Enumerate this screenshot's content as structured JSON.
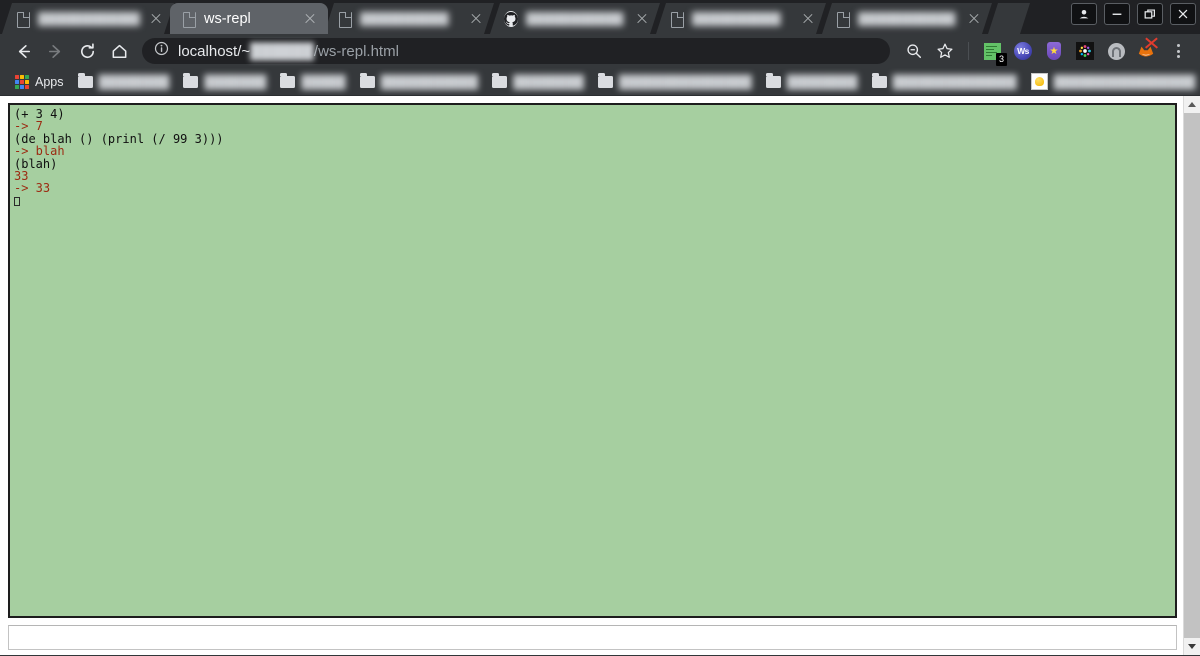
{
  "window": {
    "controls": [
      {
        "name": "profile-button",
        "icon": "person-icon"
      },
      {
        "name": "minimize-button",
        "icon": "minimize-icon"
      },
      {
        "name": "restore-button",
        "icon": "restore-icon"
      },
      {
        "name": "close-button",
        "icon": "close-icon"
      }
    ]
  },
  "tabs": [
    {
      "title": "████████████",
      "active": false,
      "favicon": "document-icon",
      "blurred": true
    },
    {
      "title": "ws-repl",
      "active": true,
      "favicon": "document-icon",
      "blurred": false
    },
    {
      "title": "██████████",
      "active": false,
      "favicon": "document-icon",
      "blurred": true
    },
    {
      "title": "███████████",
      "active": false,
      "favicon": "github-icon",
      "blurred": true
    },
    {
      "title": "██████████",
      "active": false,
      "favicon": "document-icon",
      "blurred": true
    },
    {
      "title": "███████████",
      "active": false,
      "favicon": "document-icon",
      "blurred": true
    }
  ],
  "toolbar": {
    "back": "back-arrow",
    "forward": "forward-arrow",
    "reload": "reload-icon",
    "home": "home-icon",
    "omnibox": {
      "security_icon": "info-circle-icon",
      "url_host": "localhost/~",
      "url_blurred": "██████",
      "url_path": "/ws-repl.html"
    },
    "extensions": [
      {
        "name": "zoom-icon",
        "label": ""
      },
      {
        "name": "bookmark-star-icon",
        "label": ""
      },
      {
        "name": "notes-extension-icon",
        "label": "",
        "badge": "3"
      },
      {
        "name": "ws-extension-icon",
        "label": "Ws"
      },
      {
        "name": "shield-extension-icon",
        "label": ""
      },
      {
        "name": "colorful-extension-icon",
        "label": ""
      },
      {
        "name": "privacy-lock-extension-icon",
        "label": ""
      },
      {
        "name": "fox-extension-disabled-icon",
        "label": ""
      },
      {
        "name": "chrome-menu-icon",
        "label": ""
      }
    ]
  },
  "bookmarks": {
    "apps_label": "Apps",
    "items": [
      {
        "label": "████████",
        "icon": "folder-icon"
      },
      {
        "label": "███████",
        "icon": "folder-icon"
      },
      {
        "label": "█████",
        "icon": "folder-icon"
      },
      {
        "label": "███████████",
        "icon": "folder-icon"
      },
      {
        "label": "████████",
        "icon": "folder-icon"
      },
      {
        "label": "███████████████",
        "icon": "folder-icon"
      },
      {
        "label": "████████",
        "icon": "folder-icon"
      },
      {
        "label": "██████████████",
        "icon": "folder-icon"
      },
      {
        "label": "████████████████",
        "icon": "lightbulb-icon"
      }
    ],
    "overflow": "»"
  },
  "repl": {
    "lines": [
      {
        "text": "(+ 3 4)",
        "kind": "input"
      },
      {
        "text": "-> 7",
        "kind": "result"
      },
      {
        "text": "(de blah () (prinl (/ 99 3)))",
        "kind": "input"
      },
      {
        "text": "-> blah",
        "kind": "result"
      },
      {
        "text": "(blah)",
        "kind": "input"
      },
      {
        "text": "33",
        "kind": "result"
      },
      {
        "text": "-> 33",
        "kind": "result"
      }
    ],
    "cursor": "▯",
    "input_value": "",
    "input_placeholder": ""
  },
  "colors": {
    "repl_background": "#a6cfa0",
    "repl_input_text": "#101010",
    "repl_result_text": "#9c2b12",
    "chrome_dark": "#35383b",
    "tabstrip": "#202124",
    "active_tab": "#5f6368"
  }
}
